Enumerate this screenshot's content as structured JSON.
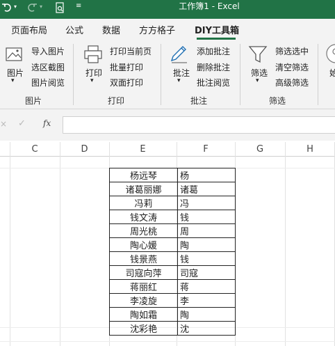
{
  "window": {
    "title": "工作簿1  -  Excel"
  },
  "tabs": [
    "页面布局",
    "公式",
    "数据",
    "方方格子",
    "DIY工具箱"
  ],
  "ribbon": {
    "groups": {
      "picture": {
        "label": "图片",
        "big_button": "图片",
        "items": [
          "导入图片",
          "选区截图",
          "图片阅览"
        ]
      },
      "print": {
        "label": "打印",
        "big_button": "打印",
        "items": [
          "打印当前页",
          "批量打印",
          "双面打印"
        ]
      },
      "comment": {
        "label": "批注",
        "big_button": "批注",
        "items": [
          "添加批注",
          "删除批注",
          "批注阅览"
        ]
      },
      "filter": {
        "label": "筛选",
        "big_button": "筛选",
        "items": [
          "筛选选中",
          "清空筛选",
          "高级筛选"
        ]
      }
    },
    "partial_next_label": "始"
  },
  "formula_bar": {
    "fx": "fx",
    "value": ""
  },
  "columns": [
    "C",
    "D",
    "E",
    "F",
    "G",
    "H"
  ],
  "table": {
    "rows": [
      [
        "杨远琴",
        "杨"
      ],
      [
        "诸葛丽娜",
        "诸葛"
      ],
      [
        "冯莉",
        "冯"
      ],
      [
        "钱文涛",
        "钱"
      ],
      [
        "周光桃",
        "周"
      ],
      [
        "陶心媛",
        "陶"
      ],
      [
        "钱景燕",
        "钱"
      ],
      [
        "司寇向萍",
        "司寇"
      ],
      [
        "蒋丽红",
        "蒋"
      ],
      [
        "李凌旋",
        "李"
      ],
      [
        "陶如霜",
        "陶"
      ],
      [
        "沈彩艳",
        "沈"
      ]
    ]
  },
  "colors": {
    "accent": "#217346",
    "ribbon_bg": "#f3f3f3"
  }
}
